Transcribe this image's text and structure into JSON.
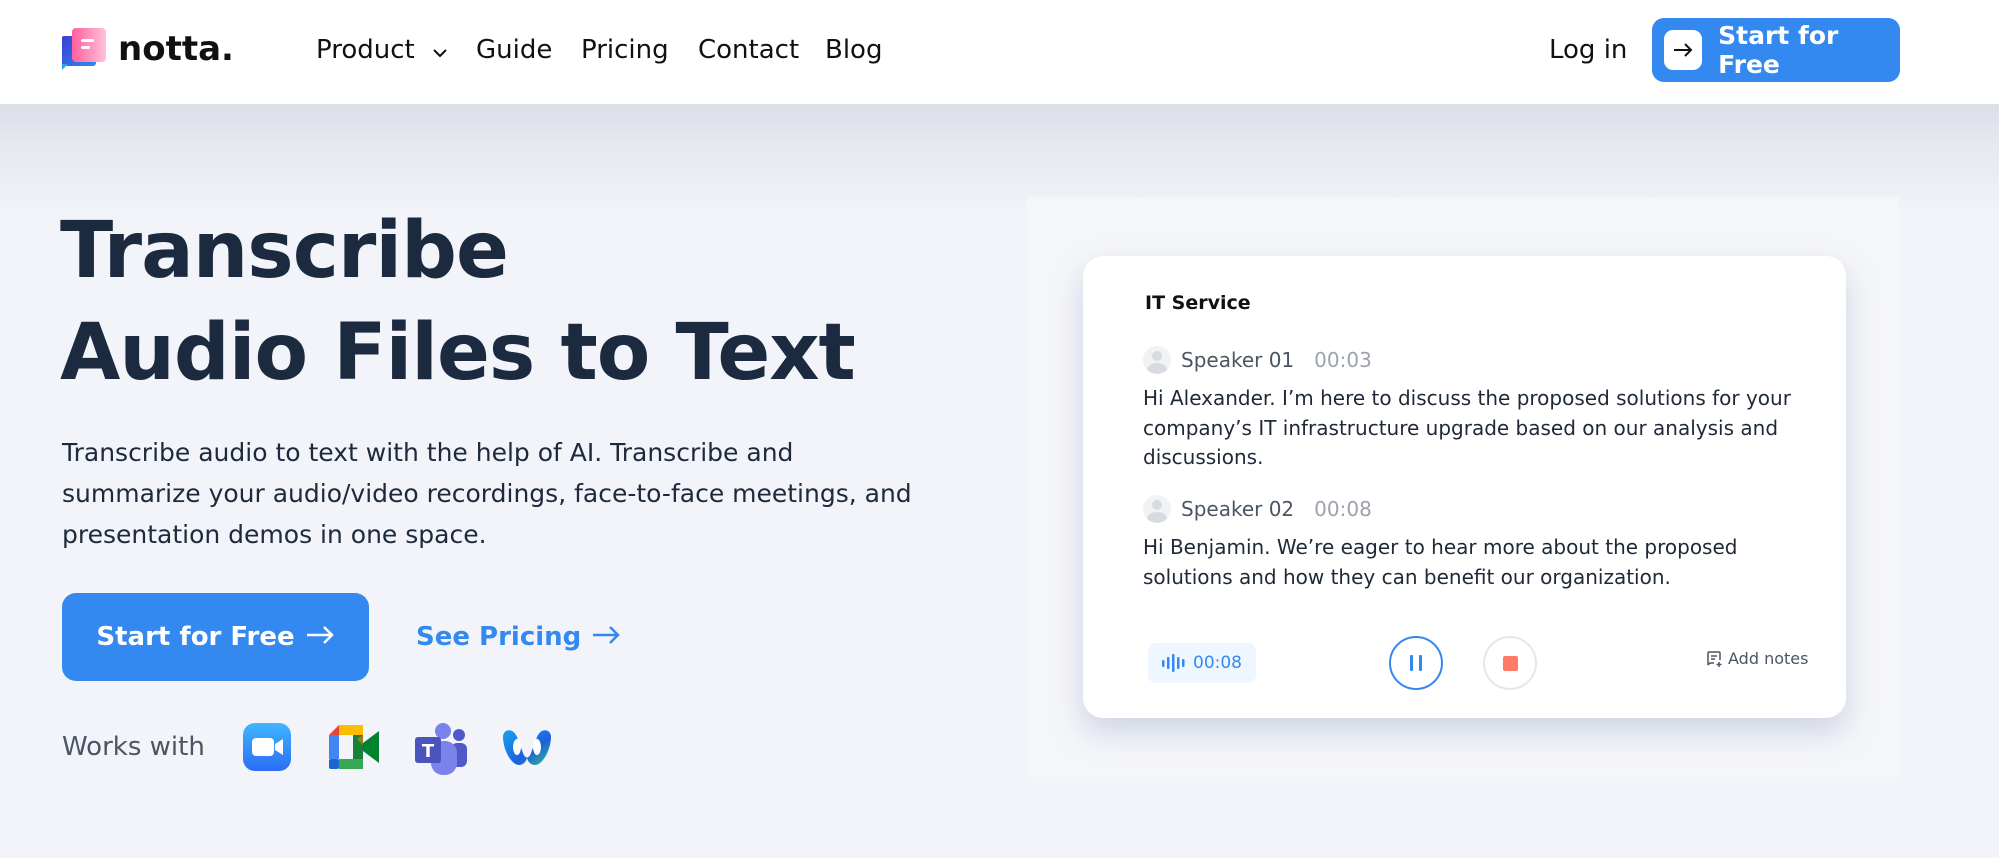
{
  "header": {
    "brand": "notta.",
    "nav": [
      {
        "label": "Product",
        "has_dropdown": true
      },
      {
        "label": "Guide"
      },
      {
        "label": "Pricing"
      },
      {
        "label": "Contact"
      },
      {
        "label": "Blog"
      }
    ],
    "login_label": "Log in",
    "cta_label": "Start for Free",
    "cta_icon": "arrow-right-icon"
  },
  "hero": {
    "title_line1": "Transcribe",
    "title_line2": "Audio Files to Text",
    "description": "Transcribe audio to text with the help of AI. Transcribe and summarize your audio/video recordings, face-to-face meetings, and presentation demos in one space.",
    "primary_cta": "Start for Free",
    "secondary_cta": "See Pricing",
    "works_with_label": "Works with",
    "integrations": [
      "Zoom",
      "Google Meet",
      "Microsoft Teams",
      "Webex"
    ]
  },
  "transcript_card": {
    "title": "IT Service",
    "entries": [
      {
        "speaker": "Speaker 01",
        "time": "00:03",
        "text": "Hi Alexander. I’m here to discuss the proposed solutions for your company’s IT infrastructure upgrade based on our analysis and discussions."
      },
      {
        "speaker": "Speaker 02",
        "time": "00:08",
        "text": "Hi Benjamin. We’re eager to hear more about the proposed solutions and how they can benefit our organization."
      }
    ],
    "recording_time": "00:08",
    "add_notes_label": "Add notes"
  },
  "colors": {
    "brand_blue": "#3389f0",
    "heading": "#1c2a40",
    "stop_red": "#ff7b67",
    "page_bg": "#f2f4f9"
  }
}
